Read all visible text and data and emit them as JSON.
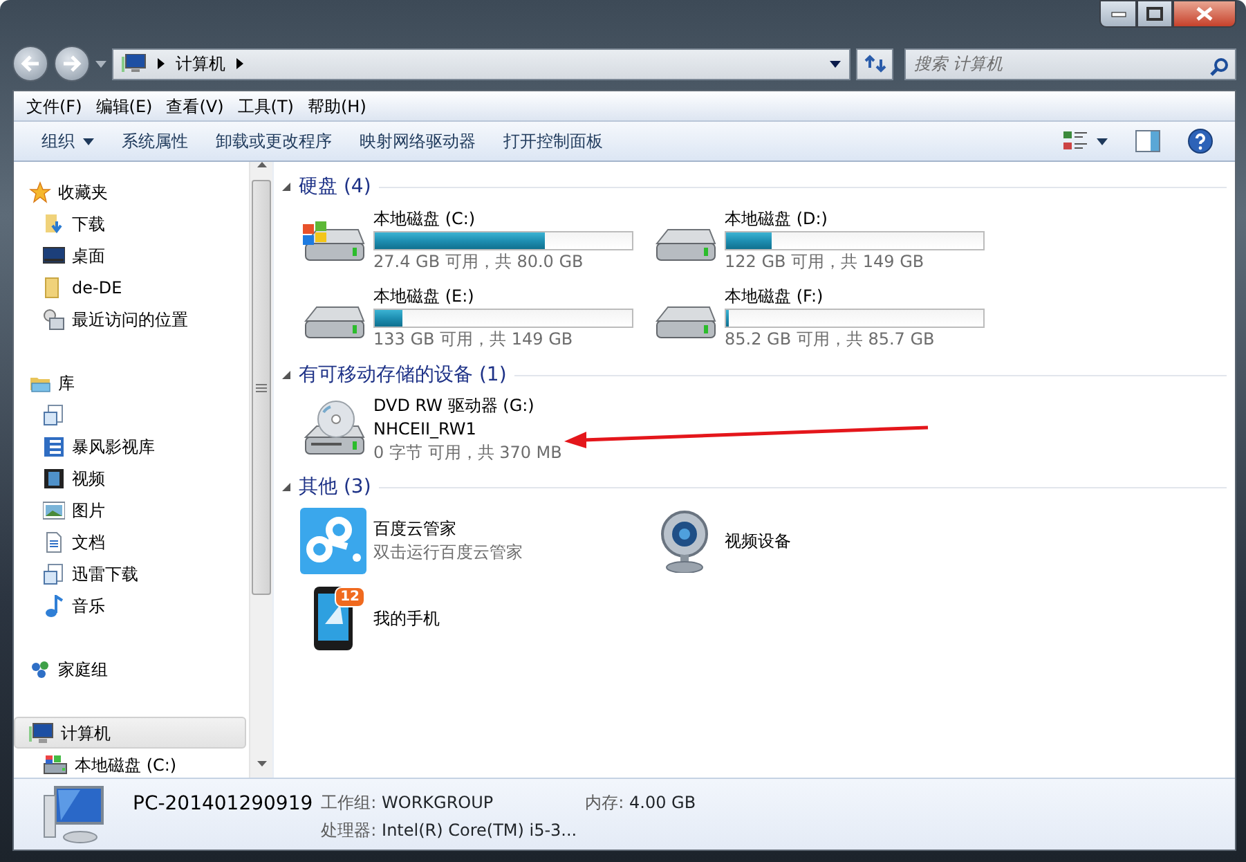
{
  "address_bar": {
    "path": [
      "计算机"
    ]
  },
  "search": {
    "placeholder": "搜索 计算机"
  },
  "menu": [
    "文件(F)",
    "编辑(E)",
    "查看(V)",
    "工具(T)",
    "帮助(H)"
  ],
  "toolbar": [
    {
      "label": "组织",
      "dropdown": true
    },
    {
      "label": "系统属性",
      "dropdown": false
    },
    {
      "label": "卸载或更改程序",
      "dropdown": false
    },
    {
      "label": "映射网络驱动器",
      "dropdown": false
    },
    {
      "label": "打开控制面板",
      "dropdown": false
    }
  ],
  "sidebar": {
    "groups": [
      {
        "label": "收藏夹",
        "selected": false,
        "children": [
          {
            "label": "下载",
            "selected": false
          },
          {
            "label": "桌面",
            "selected": false
          },
          {
            "label": "de-DE",
            "selected": false
          },
          {
            "label": "最近访问的位置",
            "selected": false
          }
        ]
      },
      {
        "label": "库",
        "selected": false,
        "children": [
          {
            "selected": false
          },
          {
            "label": "暴风影视库",
            "selected": false
          },
          {
            "label": "视频",
            "selected": false
          },
          {
            "label": "图片",
            "selected": false
          },
          {
            "label": "文档",
            "selected": false
          },
          {
            "label": "迅雷下载",
            "selected": false
          },
          {
            "label": "音乐",
            "selected": false
          }
        ]
      },
      {
        "label": "家庭组",
        "selected": false
      },
      {
        "label": "计算机",
        "selected": true,
        "children": [
          {
            "label": "本地磁盘 (C:)",
            "selected": false
          }
        ]
      }
    ]
  },
  "groups": [
    {
      "title": "硬盘 (4)",
      "items": [
        {
          "kind": "drive",
          "system": true,
          "name": "本地磁盘 (C:)",
          "level": 0.66,
          "caption": "27.4 GB 可用，共 80.0 GB"
        },
        {
          "kind": "drive",
          "system": false,
          "name": "本地磁盘 (D:)",
          "level": 0.18,
          "caption": "122 GB 可用，共 149 GB"
        },
        {
          "kind": "drive",
          "system": false,
          "name": "本地磁盘 (E:)",
          "level": 0.11,
          "caption": "133 GB 可用，共 149 GB"
        },
        {
          "kind": "drive",
          "system": false,
          "name": "本地磁盘 (F:)",
          "level": 0.01,
          "caption": "85.2 GB 可用，共 85.7 GB"
        }
      ]
    },
    {
      "title": "有可移动存储的设备 (1)",
      "items": [
        {
          "kind": "optical",
          "name": "DVD RW 驱动器 (G:)",
          "label": "NHCEII_RW1",
          "caption": "0 字节 可用，共 370 MB"
        }
      ]
    },
    {
      "title": "其他 (3)",
      "items": [
        {
          "kind": "app",
          "name": "百度云管家",
          "caption": "双击运行百度云管家"
        },
        {
          "kind": "camera",
          "name": "视频设备"
        },
        {
          "kind": "phone",
          "name": "我的手机",
          "badge": "12"
        }
      ]
    }
  ],
  "details": {
    "name": "PC-201401290919",
    "fields": [
      {
        "label": "工作组:",
        "value": "WORKGROUP"
      },
      {
        "label": "内存:",
        "value": "4.00 GB"
      },
      {
        "label": "处理器:",
        "value": "Intel(R) Core(TM) i5-3..."
      }
    ]
  }
}
